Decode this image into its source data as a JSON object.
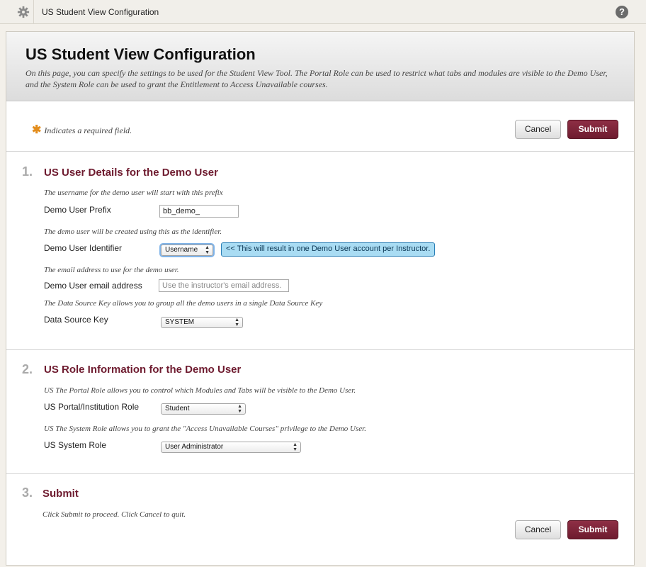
{
  "topbar": {
    "breadcrumb": "US Student View Configuration",
    "help_label": "?"
  },
  "header": {
    "title": "US Student View Configuration",
    "description": "On this page, you can specify the settings to be used for the Student View Tool. The Portal Role can be used to restrict what tabs and modules are visible to the Demo User, and the System Role can be used to grant the Entitlement to Access Unavailable courses."
  },
  "required_note": "Indicates a required field.",
  "buttons": {
    "cancel": "Cancel",
    "submit": "Submit"
  },
  "section1": {
    "number": "1.",
    "title": "US User Details for the Demo User",
    "prefix_hint": "The username for the demo user will start with this prefix",
    "prefix_label": "Demo User Prefix",
    "prefix_value": "bb_demo_",
    "identifier_hint": "The demo user will be created using this as the identifier.",
    "identifier_label": "Demo User Identifier",
    "identifier_value": "Username",
    "identifier_tooltip": "<< This will result in one Demo User account per Instructor.",
    "email_hint": "The email address to use for the demo user.",
    "email_label": "Demo User email address",
    "email_placeholder": "Use the instructor's email address.",
    "dsk_hint": "The Data Source Key allows you to group all the demo users in a single Data Source Key",
    "dsk_label": "Data Source Key",
    "dsk_value": "SYSTEM"
  },
  "section2": {
    "number": "2.",
    "title": "US Role Information for the Demo User",
    "portal_hint": "US The Portal Role allows you to control which Modules and Tabs will be visible to the Demo User.",
    "portal_label": "US Portal/Institution Role",
    "portal_value": "Student",
    "system_hint": "US The System Role allows you to grant the \"Access Unavailable Courses\" privilege to the Demo User.",
    "system_label": "US System Role",
    "system_value": "User Administrator"
  },
  "section3": {
    "number": "3.",
    "title": "Submit",
    "hint": "Click Submit to proceed. Click Cancel to quit."
  },
  "colors": {
    "accent": "#6e1b2f",
    "required_star": "#e38d1d",
    "tooltip_bg": "#a9dcf3"
  }
}
